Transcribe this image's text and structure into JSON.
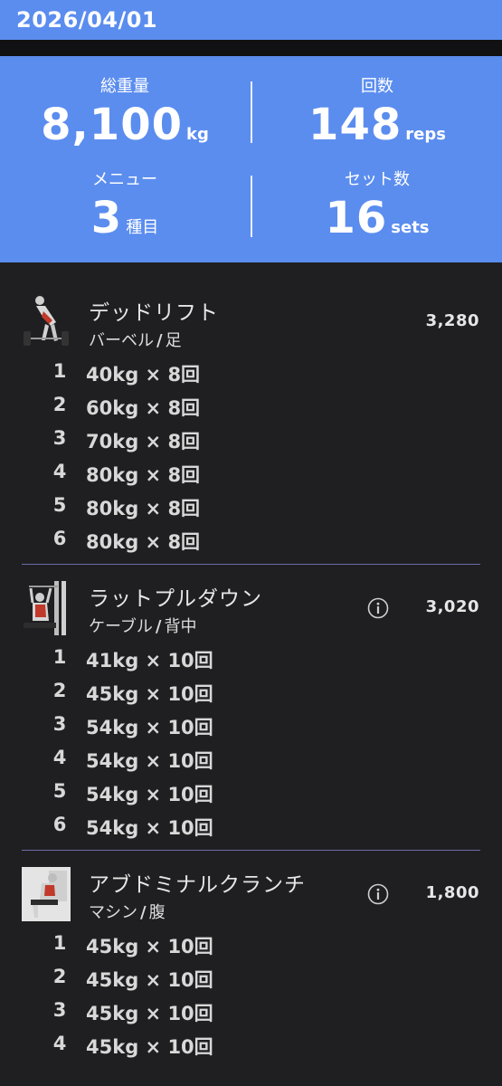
{
  "header": {
    "date": "2026/04/01"
  },
  "summary": {
    "total_weight": {
      "label": "総重量",
      "value": "8,100",
      "unit": "kg"
    },
    "reps": {
      "label": "回数",
      "value": "148",
      "unit": "reps"
    },
    "menu": {
      "label": "メニュー",
      "value": "3",
      "unit": "種目"
    },
    "sets": {
      "label": "セット数",
      "value": "16",
      "unit": "sets"
    }
  },
  "colors": {
    "accent": "#5b8def",
    "background": "#1f1f21",
    "separator": "#6c6ca8"
  },
  "exercises": [
    {
      "name": "デッドリフト",
      "equipment": "バーベル",
      "slash": "/",
      "body_part": "足",
      "total": "3,280",
      "icon": "deadlift-illustration",
      "has_info": false,
      "sets": [
        {
          "no": "1",
          "value": "40kg × 8回"
        },
        {
          "no": "2",
          "value": "60kg × 8回"
        },
        {
          "no": "3",
          "value": "70kg × 8回"
        },
        {
          "no": "4",
          "value": "80kg × 8回"
        },
        {
          "no": "5",
          "value": "80kg × 8回"
        },
        {
          "no": "6",
          "value": "80kg × 8回"
        }
      ]
    },
    {
      "name": "ラットプルダウン",
      "equipment": "ケーブル",
      "slash": "/",
      "body_part": "背中",
      "total": "3,020",
      "icon": "lat-pulldown-illustration",
      "has_info": true,
      "sets": [
        {
          "no": "1",
          "value": "41kg × 10回"
        },
        {
          "no": "2",
          "value": "45kg × 10回"
        },
        {
          "no": "3",
          "value": "54kg × 10回"
        },
        {
          "no": "4",
          "value": "54kg × 10回"
        },
        {
          "no": "5",
          "value": "54kg × 10回"
        },
        {
          "no": "6",
          "value": "54kg × 10回"
        }
      ]
    },
    {
      "name": "アブドミナルクランチ",
      "equipment": "マシン",
      "slash": "/",
      "body_part": "腹",
      "total": "1,800",
      "icon": "abdominal-crunch-illustration",
      "has_info": true,
      "sets": [
        {
          "no": "1",
          "value": "45kg × 10回"
        },
        {
          "no": "2",
          "value": "45kg × 10回"
        },
        {
          "no": "3",
          "value": "45kg × 10回"
        },
        {
          "no": "4",
          "value": "45kg × 10回"
        }
      ]
    }
  ]
}
